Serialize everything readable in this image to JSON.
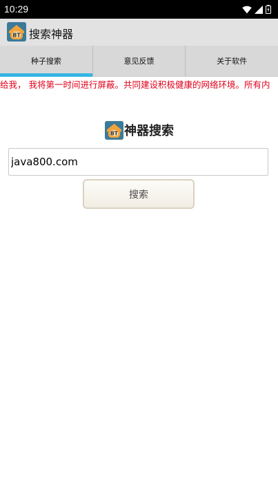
{
  "status_bar": {
    "time": "10:29"
  },
  "app": {
    "title": "搜索神器",
    "logo_text": "BT"
  },
  "tabs": [
    {
      "label": "种子搜索",
      "active": true
    },
    {
      "label": "意见反馈",
      "active": false
    },
    {
      "label": "关于软件",
      "active": false
    }
  ],
  "notice": {
    "text": "给我， 我将第一时间进行屏蔽。共同建设积极健康的网络环境。所有内"
  },
  "search": {
    "heading": "神器搜索",
    "input_value": "java800.com",
    "button_label": "搜索"
  },
  "colors": {
    "accent": "#33b5e5",
    "notice_text": "#e0001b",
    "logo_bg": "#3b7a99",
    "logo_roof": "#f2a23a"
  }
}
